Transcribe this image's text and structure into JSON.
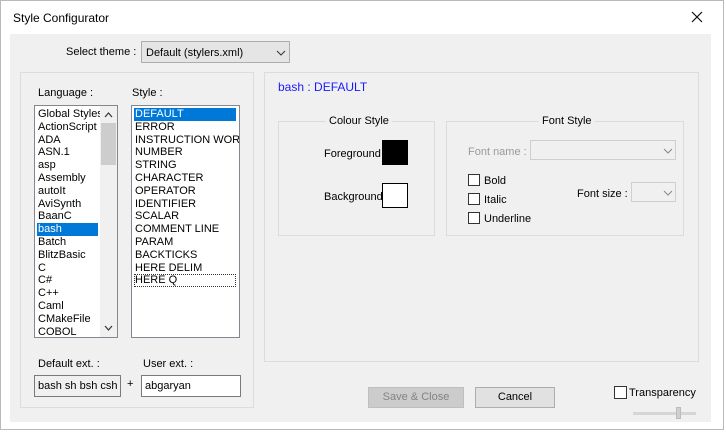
{
  "window": {
    "title": "Style Configurator"
  },
  "theme": {
    "label": "Select theme :",
    "value": "Default (stylers.xml)"
  },
  "labels": {
    "language": "Language :",
    "style": "Style :",
    "default_ext": "Default ext. :",
    "user_ext": "User ext. :",
    "plus": "+"
  },
  "languages": [
    "Global Styles",
    "ActionScript",
    "ADA",
    "ASN.1",
    "asp",
    "Assembly",
    "autoIt",
    "AviSynth",
    "BaanC",
    "bash",
    "Batch",
    "BlitzBasic",
    "C",
    "C#",
    "C++",
    "Caml",
    "CMakeFile",
    "COBOL"
  ],
  "selected_language": "bash",
  "styles": [
    "DEFAULT",
    "ERROR",
    "INSTRUCTION WORD",
    "NUMBER",
    "STRING",
    "CHARACTER",
    "OPERATOR",
    "IDENTIFIER",
    "SCALAR",
    "COMMENT LINE",
    "PARAM",
    "BACKTICKS",
    "HERE DELIM",
    "HERE Q"
  ],
  "selected_style": "DEFAULT",
  "focused_style": "HERE Q",
  "default_ext_value": "bash sh bsh csh b",
  "user_ext_value": "abgaryan",
  "panel_title": "bash : DEFAULT",
  "colour_style": {
    "title": "Colour Style",
    "foreground_label": "Foreground",
    "background_label": "Background",
    "foreground_color": "#000000",
    "background_color": "#ffffff"
  },
  "font_style": {
    "title": "Font Style",
    "font_name_label": "Font name :",
    "bold_label": "Bold",
    "italic_label": "Italic",
    "underline_label": "Underline",
    "font_size_label": "Font size :"
  },
  "buttons": {
    "save_close": "Save & Close",
    "cancel": "Cancel"
  },
  "transparency": {
    "label": "Transparency",
    "checked": false
  },
  "colors": {
    "selection": "#0078d7",
    "panel_title": "#1a1aff"
  }
}
